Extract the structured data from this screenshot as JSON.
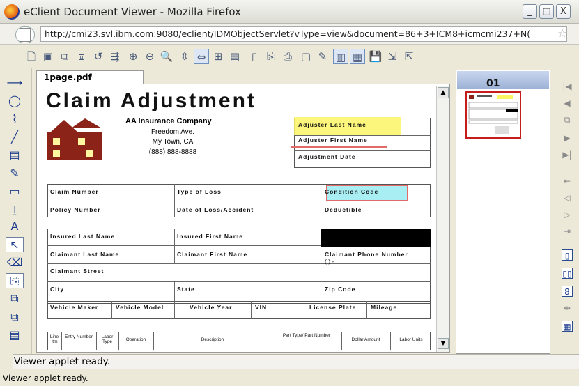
{
  "window": {
    "title": "eClient Document Viewer - Mozilla Firefox",
    "minimize": "_",
    "maximize": "□",
    "close": "X"
  },
  "address": {
    "url": "http://cmi23.svl.ibm.com:9080/eclient/IDMObjectServlet?vType=view&document=86+3+ICM8+icmcmi237+N("
  },
  "tab": {
    "label": "1page.pdf"
  },
  "document": {
    "title": "Claim Adjustment",
    "company": "AA Insurance Company",
    "address_lines": [
      "Freedom Ave.",
      "My Town, CA",
      "(888) 888-8888"
    ],
    "fields_top": [
      "Adjuster Last Name",
      "Adjuster First Name",
      "Adjustment Date"
    ],
    "row1": [
      "Claim Number",
      "Type of Loss",
      "Condition Code"
    ],
    "row2": [
      "Policy Number",
      "Date of Loss/Accident",
      "Deductible"
    ],
    "row3": [
      "Insured Last Name",
      "Insured First Name"
    ],
    "row4": [
      "Claimant Last Name",
      "Claimant First Name",
      "Claimant Phone Number"
    ],
    "phone_placeholder": "(    )    -",
    "row5": [
      "Claimant Street"
    ],
    "row6": [
      "City",
      "State",
      "Zip Code"
    ],
    "row7": [
      "Vehicle Maker",
      "Vehicle Model",
      "Vehicle Year",
      "VIN",
      "License Plate",
      "Mileage"
    ],
    "table_headers": [
      "Line Itm",
      "Entry Number",
      "Labor Type",
      "Operation",
      "Description",
      "Part Type/ Part Number",
      "Dollar Amount",
      "Labor Units"
    ]
  },
  "thumbnails": {
    "page_number": "01"
  },
  "status": {
    "applet_status": "Viewer applet ready.",
    "browser_status": "Viewer applet ready."
  },
  "colors": {
    "highlight_yellow": "#fbf565",
    "highlight_cyan": "#a8eef3",
    "redline": "#e26a6a",
    "house": "#8b2318"
  }
}
